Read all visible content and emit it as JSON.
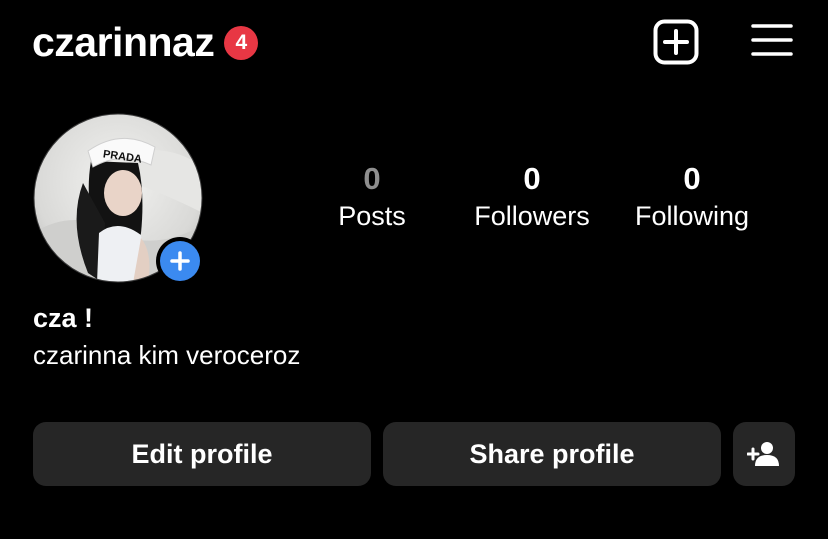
{
  "header": {
    "username": "czarinnaz",
    "notification_count": "4",
    "icons": {
      "create": "plus-square-icon",
      "menu": "hamburger-menu-icon"
    }
  },
  "profile": {
    "avatar_icon": "profile-photo",
    "add_story_icon": "plus-icon",
    "display_name": "cza !",
    "bio": "czarinna kim veroceroz"
  },
  "stats": [
    {
      "value": "0",
      "label": "Posts"
    },
    {
      "value": "0",
      "label": "Followers"
    },
    {
      "value": "0",
      "label": "Following"
    }
  ],
  "actions": {
    "edit_label": "Edit profile",
    "share_label": "Share profile",
    "add_person_icon": "add-person-icon"
  },
  "colors": {
    "background": "#000000",
    "text": "#ffffff",
    "badge": "#e83744",
    "accent": "#3b8af0",
    "button_bg": "#262626",
    "muted": "#8e8e8e"
  }
}
